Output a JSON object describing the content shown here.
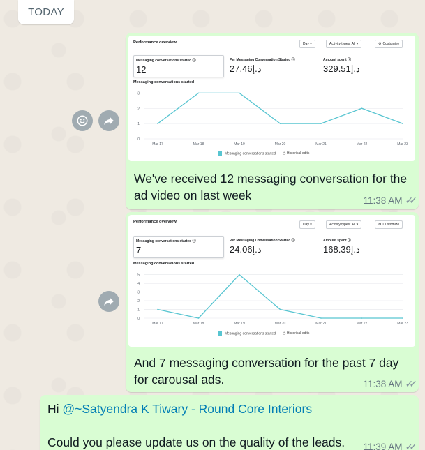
{
  "date_chip": "TODAY",
  "messages": [
    {
      "caption": "We've received 12 messaging conversation for the ad video on last week",
      "time": "11:38 AM",
      "card": {
        "title": "Performance overview",
        "controls": [
          "Day ▾",
          "Activity types: All ▾",
          "Customize"
        ],
        "metrics": [
          {
            "label": "Messaging conversations started ⓘ",
            "value": "12"
          },
          {
            "label": "Per Messaging Conversation Started ⓘ",
            "value": "27.46د.إ"
          },
          {
            "label": "Amount spent ⓘ",
            "value": "329.51د.إ"
          }
        ],
        "chart_title": "Messaging conversations started",
        "legend_series": "Messaging conversations started",
        "legend_edits": "Historical edits"
      }
    },
    {
      "caption": "And 7 messaging conversation for the past 7 day for carousal ads.",
      "time": "11:38 AM",
      "card": {
        "title": "Performance overview",
        "controls": [
          "Day ▾",
          "Activity types: All ▾",
          "Customize"
        ],
        "metrics": [
          {
            "label": "Messaging conversations started ⓘ",
            "value": "7"
          },
          {
            "label": "Per Messaging Conversation Started ⓘ",
            "value": "24.06د.إ"
          },
          {
            "label": "Amount spent ⓘ",
            "value": "168.39د.إ"
          }
        ],
        "chart_title": "Messaging conversations started",
        "legend_series": "Messaging conversations started",
        "legend_edits": "Historical edits"
      }
    },
    {
      "greeting": "Hi ",
      "mention": "@~Satyendra K Tiwary - Round Core Interiors",
      "body": "Could you please update us on the quality of the leads.",
      "time": "11:39 AM"
    }
  ],
  "chart_data": [
    {
      "type": "line",
      "categories": [
        "Mar 17",
        "Mar 18",
        "Mar 19",
        "Mar 20",
        "Mar 21",
        "Mar 22",
        "Mar 23"
      ],
      "series": [
        {
          "name": "Messaging conversations started",
          "values": [
            1,
            3,
            3,
            1,
            1,
            2,
            1
          ]
        }
      ],
      "yticks": [
        0,
        1,
        2,
        3
      ],
      "ylim": [
        0,
        3.2
      ],
      "color": "#58c5d1"
    },
    {
      "type": "line",
      "categories": [
        "Mar 17",
        "Mar 18",
        "Mar 19",
        "Mar 20",
        "Mar 21",
        "Mar 22",
        "Mar 23"
      ],
      "series": [
        {
          "name": "Messaging conversations started",
          "values": [
            1,
            0,
            5,
            1,
            0,
            0,
            0
          ]
        }
      ],
      "yticks": [
        0,
        1,
        2,
        3,
        4,
        5
      ],
      "ylim": [
        0,
        5.3
      ],
      "color": "#58c5d1"
    }
  ],
  "colors": {
    "outgoing_bubble": "#d9fdd3",
    "background": "#efeae2",
    "mention": "#027eb5",
    "ticks": "#8696a0"
  },
  "icons": [
    "emoji-icon",
    "forward-icon",
    "double-check-icon",
    "gear-icon",
    "history-icon"
  ]
}
